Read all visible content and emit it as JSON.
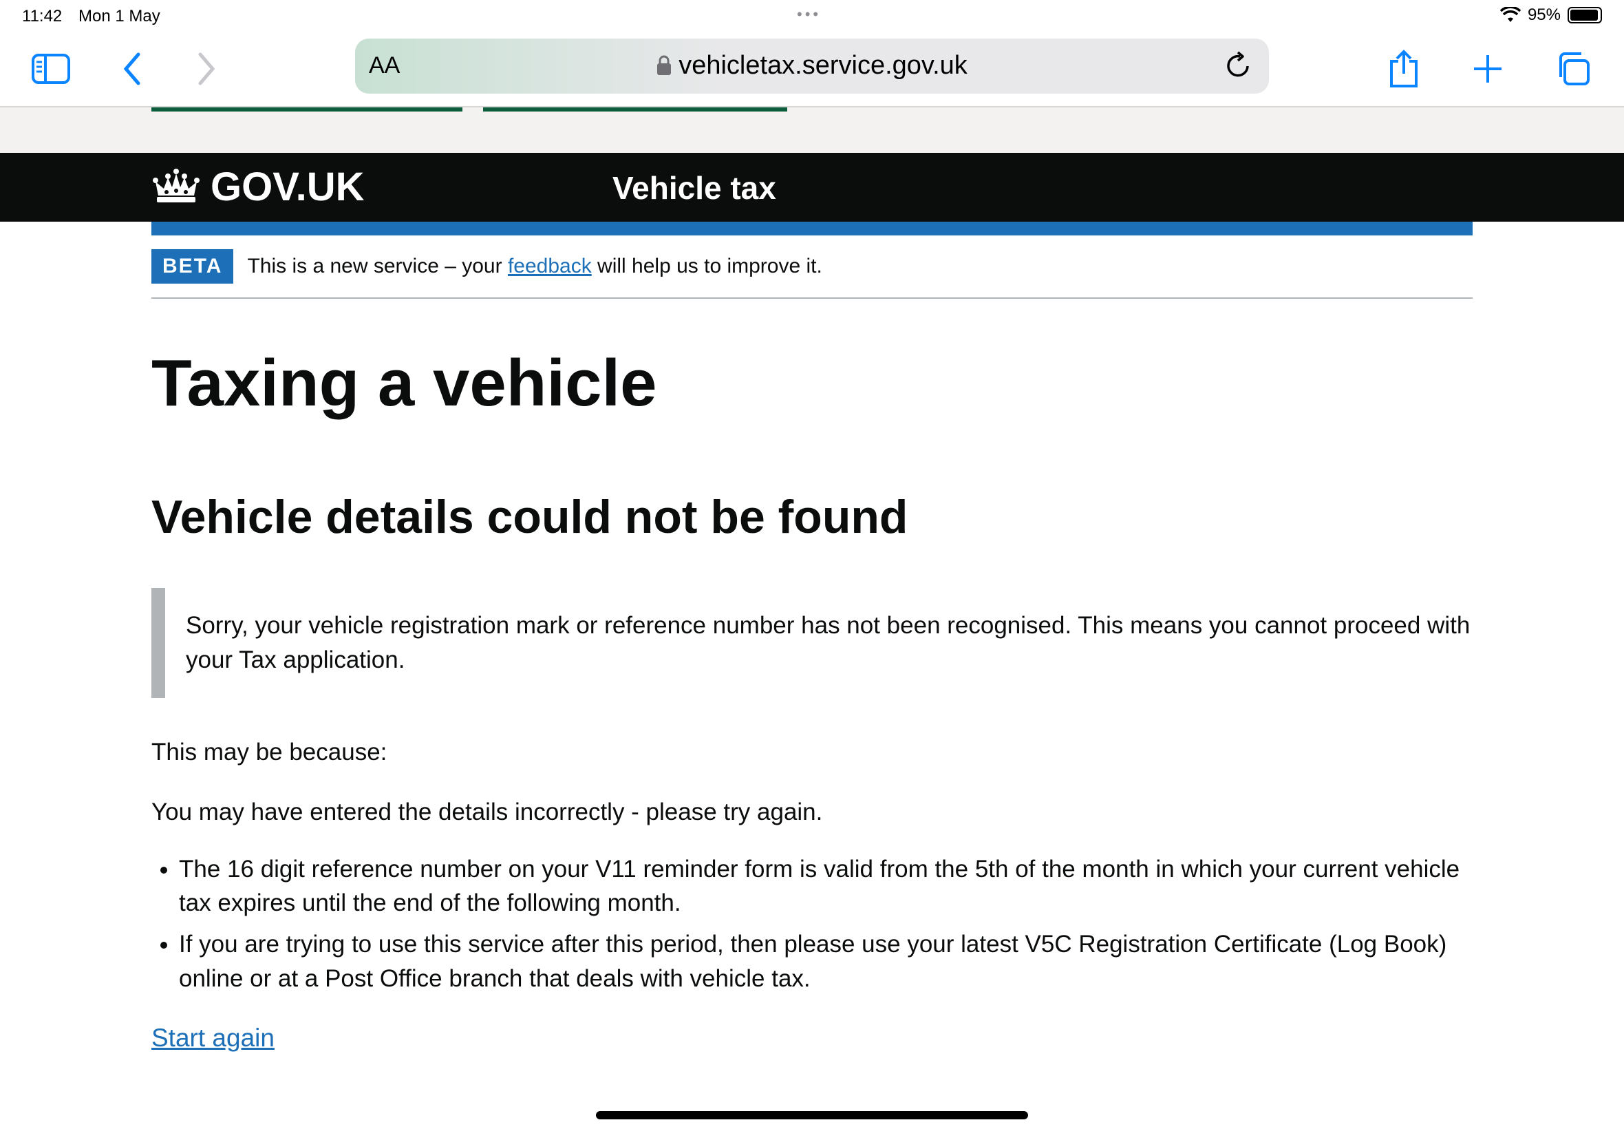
{
  "status_bar": {
    "time": "11:42",
    "date": "Mon 1 May",
    "battery": "95%",
    "battery_level": 0.95
  },
  "browser": {
    "aa_label": "AA",
    "url": "vehicletax.service.gov.uk"
  },
  "header": {
    "logo_text": "GOV.UK",
    "service_name": "Vehicle tax"
  },
  "phase_banner": {
    "tag": "BETA",
    "text_before": "This is a new service – your ",
    "link": "feedback",
    "text_after": " will help us to improve it."
  },
  "main": {
    "title": "Taxing a vehicle",
    "heading": "Vehicle details could not be found",
    "inset": "Sorry, your vehicle registration mark or reference number has not been recognised. This means you cannot proceed with your Tax application.",
    "para1": "This may be because:",
    "para2": "You may have entered the details incorrectly - please try again.",
    "bullets": [
      "The 16 digit reference number on your V11 reminder form is valid from the 5th of the month in which your current vehicle tax expires until the end of the following month.",
      "If you are trying to use this service after this period, then please use your latest V5C Registration Certificate (Log Book) online or at a Post Office branch that deals with vehicle tax."
    ],
    "start_again": "Start again"
  },
  "colors": {
    "gov_black": "#0b0c0c",
    "gov_blue": "#1d70b8",
    "safari_blue": "#0a84ff",
    "inset_border": "#b1b4b6"
  }
}
